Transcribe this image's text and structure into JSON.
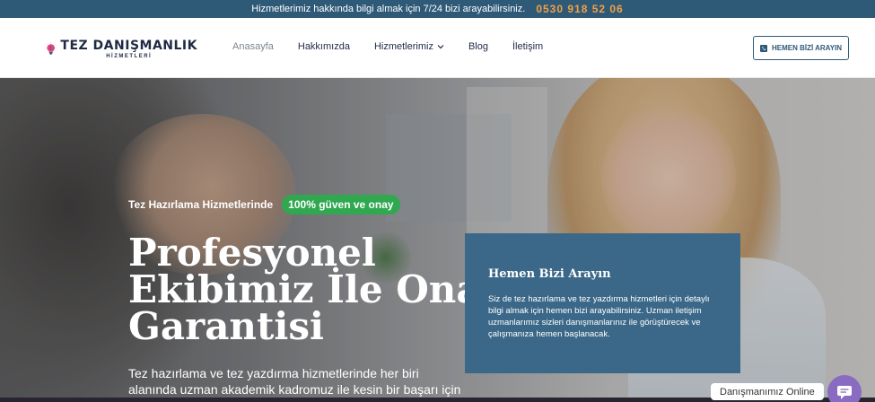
{
  "topbar": {
    "message": "Hizmetlerimiz hakkında bilgi almak için 7/24 bizi arayabilirsiniz.",
    "phone": "0530 918 52 06"
  },
  "brand": {
    "name": "TEZ DANIŞMANLIK",
    "sub": "HİZMETLERİ",
    "logo_icon": "brain-bulb-icon"
  },
  "nav": {
    "items": [
      {
        "label": "Anasayfa",
        "active": true
      },
      {
        "label": "Hakkımızda"
      },
      {
        "label": "Hizmetlerimiz",
        "has_dropdown": true
      },
      {
        "label": "Blog"
      },
      {
        "label": "İletişim"
      }
    ]
  },
  "cta": {
    "label": "HEMEN BİZİ ARAYIN",
    "icon": "phone-square-icon"
  },
  "hero": {
    "tagline": "Tez Hazırlama Hizmetlerinde",
    "badge": "100% güven ve onay",
    "headline_lines": [
      "Profesyonel",
      "Ekibimiz İle Onay",
      "Garantisi"
    ],
    "subtext": "Tez hazırlama ve tez yazdırma hizmetlerinde her biri alanında uzman akademik kadromuz ile kesin bir başarı için"
  },
  "contact_card": {
    "title": "Hemen Bizi Arayın",
    "body": "Siz de tez hazırlama ve tez yazdırma hizmetleri için detaylı bilgi almak için hemen bizi arayabilirsiniz. Uzman iletişim uzmanlarımız sizleri danışmanlarınız ile görüştürecek ve çalışmanıza hemen başlanacak."
  },
  "chat": {
    "label": "Danışmanımız Online",
    "icon": "chat-bubble-icon"
  },
  "colors": {
    "topbar": "#2e5a78",
    "phone": "#f0a044",
    "badge": "#2fa84f",
    "card": "#3b6888",
    "chat": "#8a6bc2"
  }
}
